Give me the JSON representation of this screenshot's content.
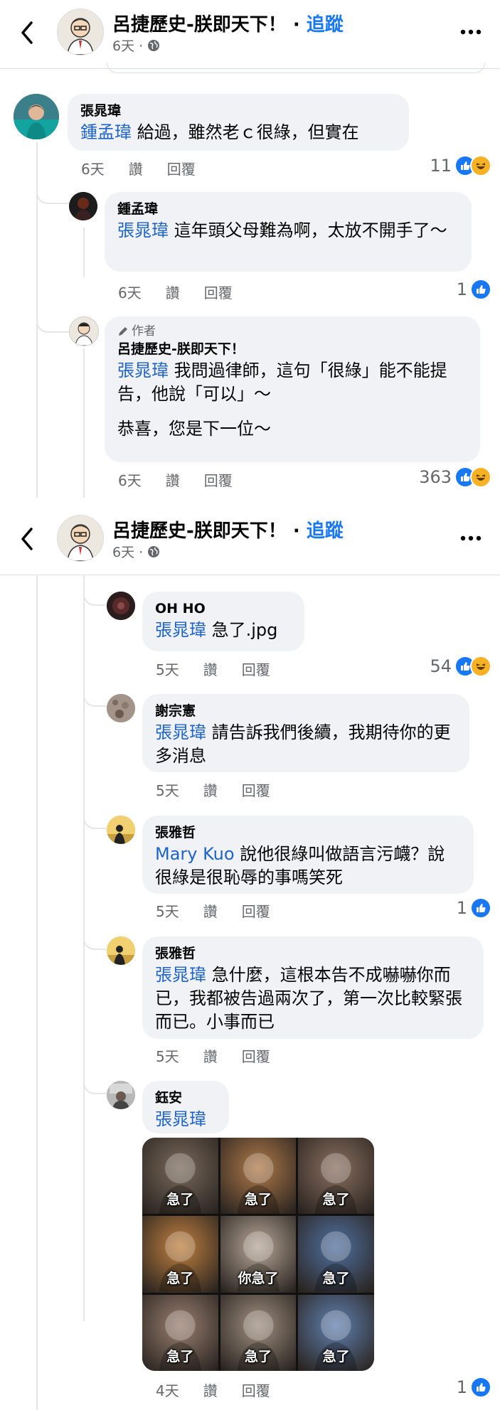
{
  "header": {
    "page_name": "呂捷歷史-朕即天下！",
    "separator": " · ",
    "follow_label": "追蹤",
    "time": "6天 ·"
  },
  "actions": {
    "like": "讚",
    "reply": "回覆"
  },
  "comments": [
    {
      "name": "張晁瑋",
      "mention": "鍾孟瑋",
      "text": " 給過，雖然老ｃ很綠，但實在",
      "time": "6天",
      "reactions": "11"
    },
    {
      "name": "鍾孟瑋",
      "mention": "張晁瑋",
      "text": " 這年頭父母難為啊，太放不開手了～",
      "time": "6天",
      "reactions": "1"
    },
    {
      "badge": "作者",
      "name": "呂捷歷史-朕即天下！",
      "mention": "張晁瑋",
      "text": " 我問過律師，這句「很綠」能不能提告，他說「可以」～",
      "text2": "恭喜，您是下一位～",
      "time": "6天",
      "reactions": "363"
    },
    {
      "name": "OH HO",
      "mention": "張晁瑋",
      "text": " 急了.jpg",
      "time": "5天",
      "reactions": "54"
    },
    {
      "name": "謝宗憲",
      "mention": "張晁瑋",
      "text": " 請告訴我們後續，我期待你的更多消息",
      "time": "5天",
      "reactions": ""
    },
    {
      "name": "張雅哲",
      "mention": "Mary Kuo",
      "text": " 說他很綠叫做語言污衊？說很綠是很恥辱的事嗎笑死",
      "time": "5天",
      "reactions": "1"
    },
    {
      "name": "張雅哲",
      "mention": "張晁瑋",
      "text": " 急什麼，這根本告不成嚇嚇你而已，我都被告過兩次了，第一次比較緊張而已。小事而已",
      "time": "5天",
      "reactions": ""
    },
    {
      "name": "鈺安",
      "mention": "張晁瑋",
      "text": "",
      "time": "4天",
      "reactions": "1"
    }
  ],
  "meme": {
    "captions": [
      "急了",
      "急了",
      "急了",
      "急了",
      "你急了",
      "急了",
      "急了",
      "急了",
      "急了"
    ],
    "colors": [
      "#7a6a5c",
      "#b07a4a",
      "#8a7060",
      "#c08040",
      "#b8a898",
      "#5070a0",
      "#9a8070",
      "#a09080",
      "#6080b0"
    ]
  }
}
